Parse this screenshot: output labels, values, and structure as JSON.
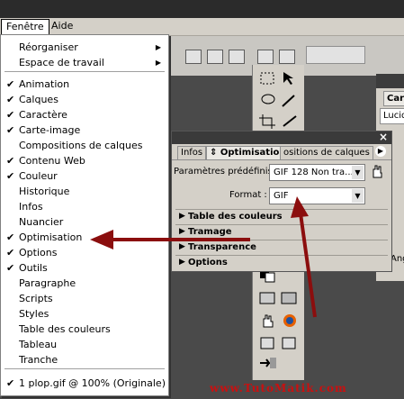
{
  "menubar": {
    "items": [
      "Fenêtre",
      "Aide"
    ]
  },
  "menu": {
    "items": [
      {
        "label": "Réorganiser",
        "checked": false,
        "submenu": true
      },
      {
        "label": "Espace de travail",
        "checked": false,
        "submenu": true
      },
      {
        "label": "Animation",
        "checked": true,
        "submenu": false
      },
      {
        "label": "Calques",
        "checked": true,
        "submenu": false
      },
      {
        "label": "Caractère",
        "checked": true,
        "submenu": false
      },
      {
        "label": "Carte-image",
        "checked": true,
        "submenu": false
      },
      {
        "label": "Compositions de calques",
        "checked": false,
        "submenu": false
      },
      {
        "label": "Contenu Web",
        "checked": true,
        "submenu": false
      },
      {
        "label": "Couleur",
        "checked": true,
        "submenu": false
      },
      {
        "label": "Historique",
        "checked": false,
        "submenu": false
      },
      {
        "label": "Infos",
        "checked": false,
        "submenu": false
      },
      {
        "label": "Nuancier",
        "checked": false,
        "submenu": false
      },
      {
        "label": "Optimisation",
        "checked": true,
        "submenu": false
      },
      {
        "label": "Options",
        "checked": true,
        "submenu": false
      },
      {
        "label": "Outils",
        "checked": true,
        "submenu": false
      },
      {
        "label": "Paragraphe",
        "checked": false,
        "submenu": false
      },
      {
        "label": "Scripts",
        "checked": false,
        "submenu": false
      },
      {
        "label": "Styles",
        "checked": false,
        "submenu": false
      },
      {
        "label": "Table des couleurs",
        "checked": false,
        "submenu": false
      },
      {
        "label": "Tableau",
        "checked": false,
        "submenu": false
      },
      {
        "label": "Tranche",
        "checked": false,
        "submenu": false
      },
      {
        "label": "1 plop.gif @ 100% (Originale)",
        "checked": true,
        "submenu": false
      }
    ],
    "check_glyph": "✔",
    "arrow_glyph": "▶"
  },
  "optimisation_panel": {
    "tabs": [
      "Infos",
      "Optimisation",
      "ositions de calques"
    ],
    "tab_opt_glyph": "⇕",
    "close_glyph": "×",
    "presets_label": "Paramètres prédéfinis :",
    "presets_value": "GIF 128 Non tra...",
    "format_label": "Format :",
    "format_value": "GIF",
    "sections": [
      "Table des couleurs",
      "Tramage",
      "Transparence",
      "Options"
    ],
    "section_glyph": "▶"
  },
  "right_panel": {
    "tab": "Cara",
    "field": "Lucid",
    "bottom": "Angla"
  },
  "watermark": "www.TutoMatik.com",
  "annotation": {
    "arrow_color": "#8b0e0e"
  }
}
